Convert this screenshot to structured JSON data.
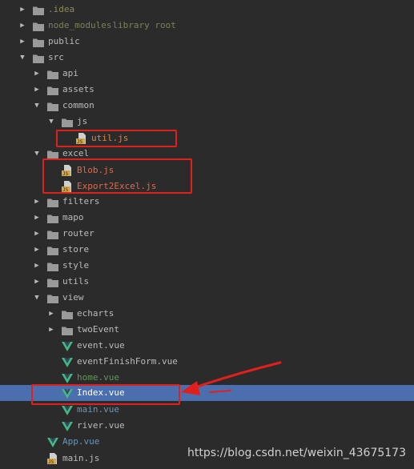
{
  "colors": {
    "background": "#2b2b2b",
    "selection": "#4b6eaf",
    "folder": "#9a9a9a",
    "js_icon": "#d8a848",
    "vue_icon": "#42b883",
    "highlight": "#e0201d"
  },
  "tree": [
    {
      "label": ".idea",
      "type": "folder",
      "expanded": false,
      "tone": "muted"
    },
    {
      "label": "node_modules",
      "suffix": " library root",
      "type": "folder",
      "expanded": false,
      "tone": "lib"
    },
    {
      "label": "public",
      "type": "folder",
      "expanded": false
    },
    {
      "label": "src",
      "type": "folder",
      "expanded": true
    },
    {
      "label": "api",
      "type": "folder",
      "expanded": false
    },
    {
      "label": "assets",
      "type": "folder",
      "expanded": false
    },
    {
      "label": "common",
      "type": "folder",
      "expanded": true
    },
    {
      "label": "js",
      "type": "folder",
      "expanded": true
    },
    {
      "label": "util.js",
      "type": "js",
      "tone": "orange"
    },
    {
      "label": "excel",
      "type": "folder",
      "expanded": true
    },
    {
      "label": "Blob.js",
      "type": "js",
      "tone": "red"
    },
    {
      "label": "Export2Excel.js",
      "type": "js",
      "tone": "red"
    },
    {
      "label": "filters",
      "type": "folder",
      "expanded": false
    },
    {
      "label": "mapo",
      "type": "folder",
      "expanded": false
    },
    {
      "label": "router",
      "type": "folder",
      "expanded": false
    },
    {
      "label": "store",
      "type": "folder",
      "expanded": false
    },
    {
      "label": "style",
      "type": "folder",
      "expanded": false
    },
    {
      "label": "utils",
      "type": "folder",
      "expanded": false
    },
    {
      "label": "view",
      "type": "folder",
      "expanded": true
    },
    {
      "label": "echarts",
      "type": "folder",
      "expanded": false
    },
    {
      "label": "twoEvent",
      "type": "folder",
      "expanded": false
    },
    {
      "label": "event.vue",
      "type": "vue"
    },
    {
      "label": "eventFinishForm.vue",
      "type": "vue"
    },
    {
      "label": "home.vue",
      "type": "vue",
      "tone": "green"
    },
    {
      "label": "Index.vue",
      "type": "vue",
      "selected": true
    },
    {
      "label": "main.vue",
      "type": "vue",
      "tone": "tealblue"
    },
    {
      "label": "river.vue",
      "type": "vue"
    },
    {
      "label": "App.vue",
      "type": "vue",
      "tone": "tealblue"
    },
    {
      "label": "main.js",
      "type": "js"
    }
  ],
  "watermark": "https://blog.csdn.net/weixin_43675173"
}
